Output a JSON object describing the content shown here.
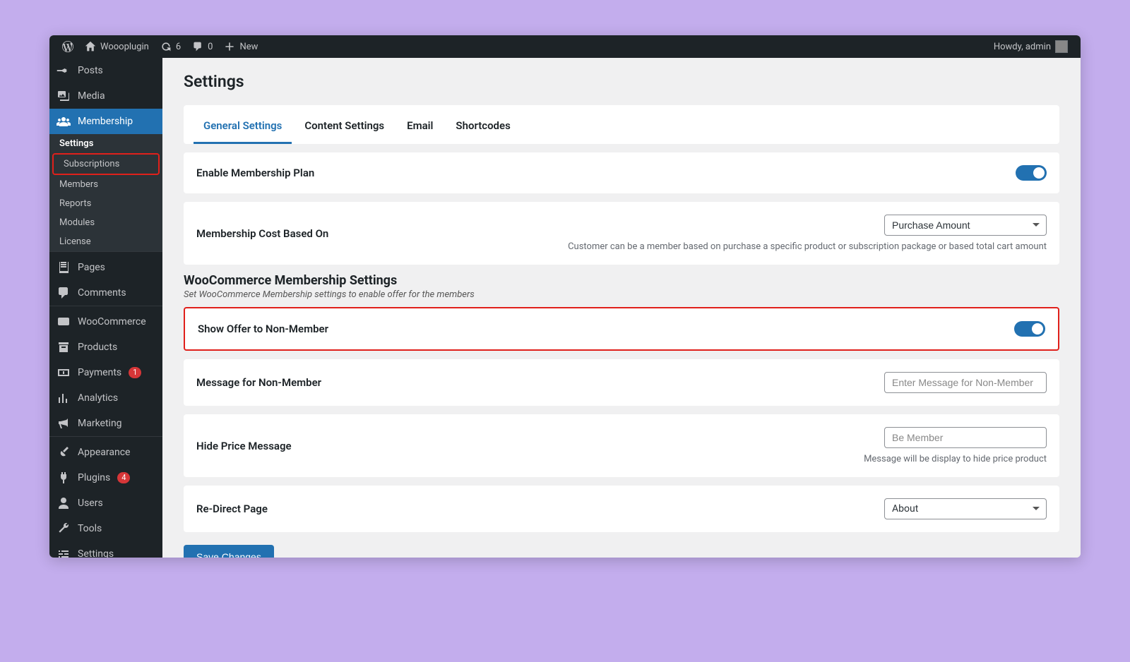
{
  "admin_bar": {
    "site_name": "Woooplugin",
    "refresh_count": "6",
    "comment_count": "0",
    "new_label": "New",
    "howdy_label": "Howdy, admin"
  },
  "sidebar": {
    "posts": "Posts",
    "media": "Media",
    "membership": "Membership",
    "sub": {
      "settings": "Settings",
      "subscriptions": "Subscriptions",
      "members": "Members",
      "reports": "Reports",
      "modules": "Modules",
      "license": "License"
    },
    "pages": "Pages",
    "comments": "Comments",
    "woocommerce": "WooCommerce",
    "products": "Products",
    "payments": "Payments",
    "payments_badge": "1",
    "analytics": "Analytics",
    "marketing": "Marketing",
    "appearance": "Appearance",
    "plugins": "Plugins",
    "plugins_badge": "4",
    "users": "Users",
    "tools": "Tools",
    "settings": "Settings"
  },
  "page": {
    "title": "Settings"
  },
  "tabs": {
    "general": "General Settings",
    "content": "Content Settings",
    "email": "Email",
    "shortcodes": "Shortcodes"
  },
  "settings": {
    "enable_plan": "Enable Membership Plan",
    "cost_based_label": "Membership Cost Based On",
    "cost_based_value": "Purchase Amount",
    "cost_based_help": "Customer can be a member based on purchase a specific product or subscription package or based total cart amount",
    "wc_title": "WooCommerce Membership Settings",
    "wc_sub": "Set WooCommerce Membership settings to enable offer for the members",
    "show_offer": "Show Offer to Non-Member",
    "msg_non_member": "Message for Non-Member",
    "msg_placeholder": "Enter Message for Non-Member",
    "hide_price": "Hide Price Message",
    "hide_price_placeholder": "Be Member",
    "hide_price_help": "Message will be display to hide price product",
    "redirect": "Re-Direct Page",
    "redirect_value": "About",
    "save": "Save Changes"
  }
}
